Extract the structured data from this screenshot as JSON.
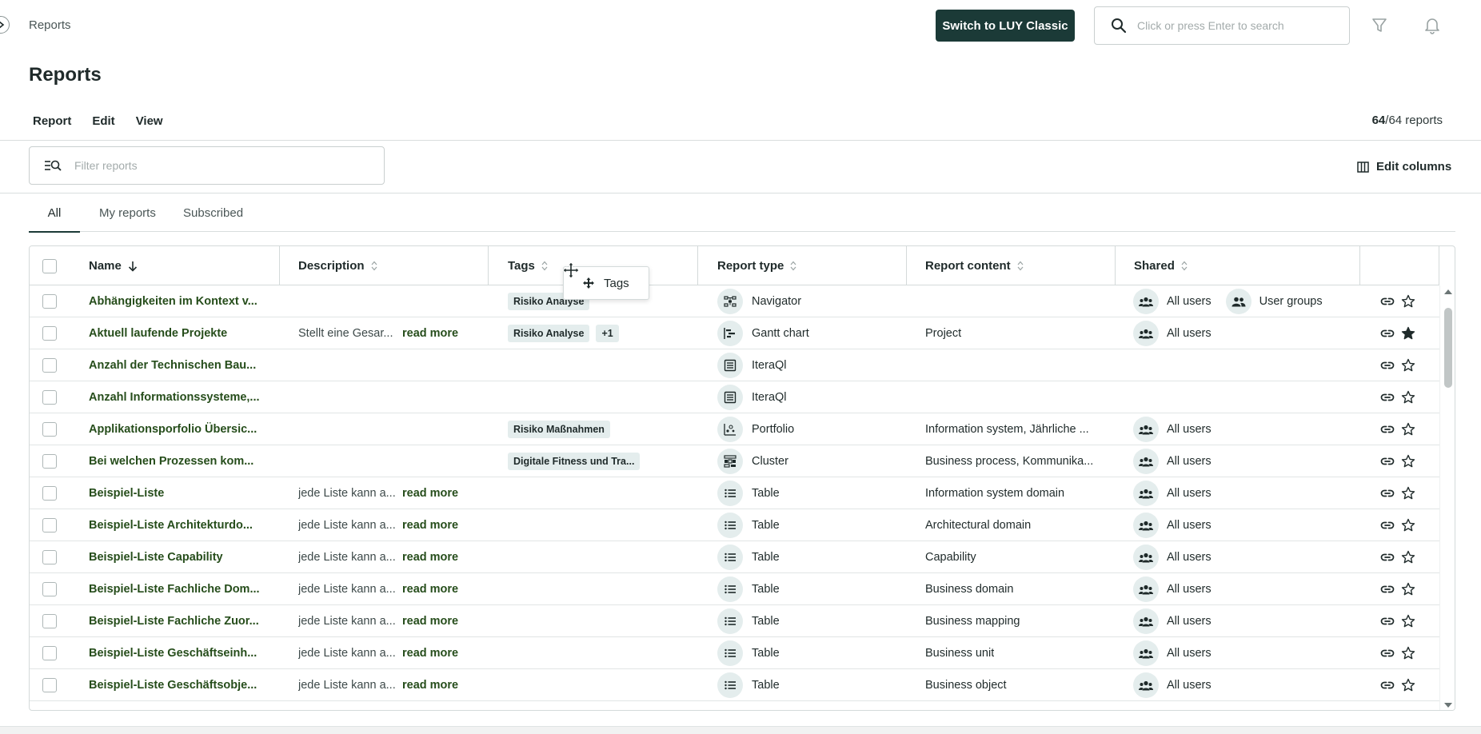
{
  "header": {
    "breadcrumb": "Reports",
    "switch_button": "Switch to LUY Classic",
    "search_placeholder": "Click or press Enter to search"
  },
  "page": {
    "title": "Reports",
    "menu": [
      "Report",
      "Edit",
      "View"
    ],
    "count_shown": "64",
    "count_total": "/64 reports",
    "filter_placeholder": "Filter reports",
    "edit_columns": "Edit columns"
  },
  "tabs": [
    "All",
    "My reports",
    "Subscribed"
  ],
  "columns": {
    "name": "Name",
    "description": "Description",
    "tags": "Tags",
    "report_type": "Report type",
    "report_content": "Report content",
    "shared": "Shared"
  },
  "drag_ghost_label": "Tags",
  "rows": [
    {
      "name": "Abhängigkeiten im Kontext v...",
      "description": "",
      "more": "",
      "tags": [
        "Risiko Analyse"
      ],
      "type": "Navigator",
      "type_icon": "navigator-icon",
      "content": "",
      "shared": [
        "All users",
        "User groups"
      ],
      "favorite": false
    },
    {
      "name": "Aktuell laufende Projekte",
      "description": "Stellt eine Gesar...",
      "more": "read more",
      "tags": [
        "Risiko Analyse",
        "+1"
      ],
      "type": "Gantt chart",
      "type_icon": "gantt-icon",
      "content": "Project",
      "shared": [
        "All users"
      ],
      "favorite": true
    },
    {
      "name": "Anzahl der Technischen Bau...",
      "description": "",
      "more": "",
      "tags": [],
      "type": "IteraQl",
      "type_icon": "iteraql-icon",
      "content": "",
      "shared": [],
      "favorite": false
    },
    {
      "name": "Anzahl Informationssysteme,...",
      "description": "",
      "more": "",
      "tags": [],
      "type": "IteraQl",
      "type_icon": "iteraql-icon",
      "content": "",
      "shared": [],
      "favorite": false
    },
    {
      "name": "Applikationsporfolio Übersic...",
      "description": "",
      "more": "",
      "tags": [
        "Risiko Maßnahmen"
      ],
      "type": "Portfolio",
      "type_icon": "portfolio-icon",
      "content": "Information system, Jährliche ...",
      "shared": [
        "All users"
      ],
      "favorite": false
    },
    {
      "name": "Bei welchen Prozessen kom...",
      "description": "",
      "more": "",
      "tags": [
        "Digitale Fitness und Tra..."
      ],
      "type": "Cluster",
      "type_icon": "cluster-icon",
      "content": "Business process, Kommunika...",
      "shared": [
        "All users"
      ],
      "favorite": false
    },
    {
      "name": "Beispiel-Liste",
      "description": "jede Liste kann a...",
      "more": "read more",
      "tags": [],
      "type": "Table",
      "type_icon": "table-icon",
      "content": "Information system domain",
      "shared": [
        "All users"
      ],
      "favorite": false
    },
    {
      "name": "Beispiel-Liste Architekturdo...",
      "description": "jede Liste kann a...",
      "more": "read more",
      "tags": [],
      "type": "Table",
      "type_icon": "table-icon",
      "content": "Architectural domain",
      "shared": [
        "All users"
      ],
      "favorite": false
    },
    {
      "name": "Beispiel-Liste Capability",
      "description": "jede Liste kann a...",
      "more": "read more",
      "tags": [],
      "type": "Table",
      "type_icon": "table-icon",
      "content": "Capability",
      "shared": [
        "All users"
      ],
      "favorite": false
    },
    {
      "name": "Beispiel-Liste Fachliche Dom...",
      "description": "jede Liste kann a...",
      "more": "read more",
      "tags": [],
      "type": "Table",
      "type_icon": "table-icon",
      "content": "Business domain",
      "shared": [
        "All users"
      ],
      "favorite": false
    },
    {
      "name": "Beispiel-Liste Fachliche Zuor...",
      "description": "jede Liste kann a...",
      "more": "read more",
      "tags": [],
      "type": "Table",
      "type_icon": "table-icon",
      "content": "Business mapping",
      "shared": [
        "All users"
      ],
      "favorite": false
    },
    {
      "name": "Beispiel-Liste Geschäftseinh...",
      "description": "jede Liste kann a...",
      "more": "read more",
      "tags": [],
      "type": "Table",
      "type_icon": "table-icon",
      "content": "Business unit",
      "shared": [
        "All users"
      ],
      "favorite": false
    },
    {
      "name": "Beispiel-Liste Geschäftsobje...",
      "description": "jede Liste kann a...",
      "more": "read more",
      "tags": [],
      "type": "Table",
      "type_icon": "table-icon",
      "content": "Business object",
      "shared": [
        "All users"
      ],
      "favorite": false
    }
  ],
  "colors": {
    "primary": "#1b3a37",
    "link_green": "#264d1b",
    "chip_bg": "#e4eded"
  }
}
